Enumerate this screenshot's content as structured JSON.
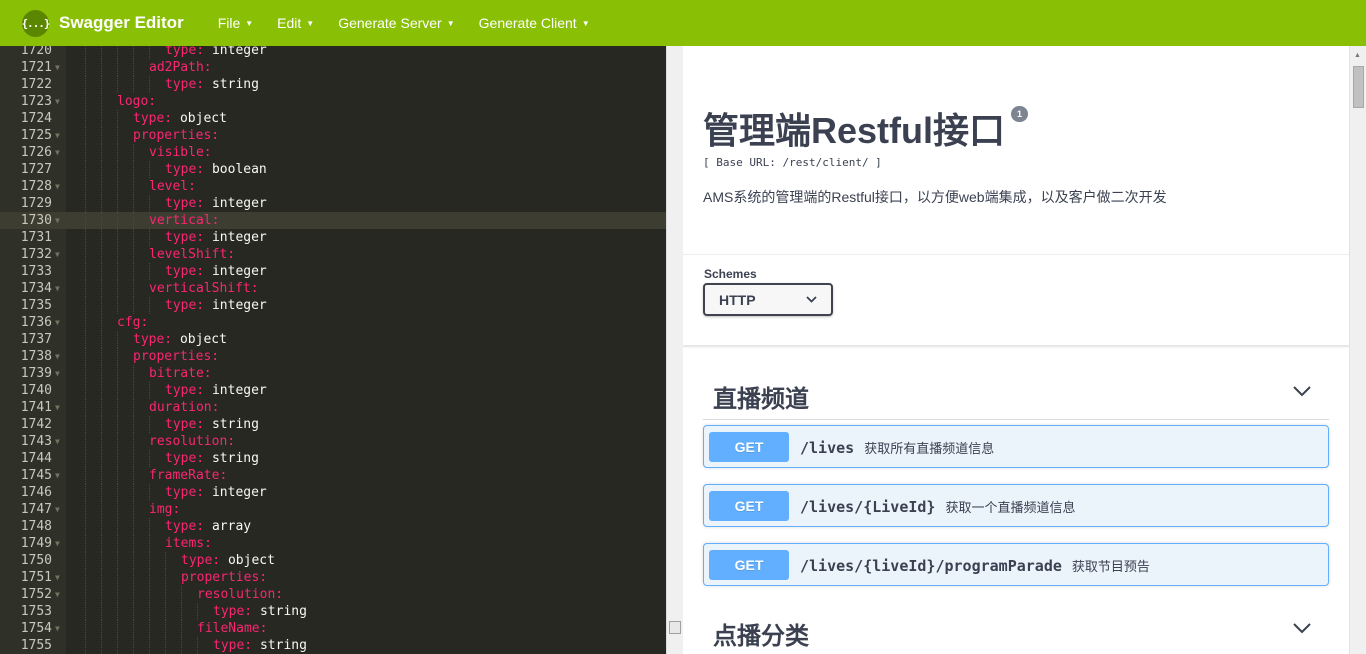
{
  "app": {
    "logo_glyph": "{...}",
    "title": "Swagger Editor",
    "menu": [
      {
        "label": "File"
      },
      {
        "label": "Edit"
      },
      {
        "label": "Generate Server"
      },
      {
        "label": "Generate Client"
      }
    ],
    "brand_color": "#89bf04"
  },
  "editor": {
    "active_line": 1730,
    "lines": [
      {
        "n": "1720",
        "indent": 6,
        "fold": false,
        "key": "type:",
        "val": " integer"
      },
      {
        "n": "1721",
        "indent": 5,
        "fold": true,
        "key": "ad2Path:",
        "val": ""
      },
      {
        "n": "1722",
        "indent": 6,
        "fold": false,
        "key": "type:",
        "val": " string"
      },
      {
        "n": "1723",
        "indent": 3,
        "fold": true,
        "key": "logo:",
        "val": ""
      },
      {
        "n": "1724",
        "indent": 4,
        "fold": false,
        "key": "type:",
        "val": " object"
      },
      {
        "n": "1725",
        "indent": 4,
        "fold": true,
        "key": "properties:",
        "val": ""
      },
      {
        "n": "1726",
        "indent": 5,
        "fold": true,
        "key": "visible:",
        "val": ""
      },
      {
        "n": "1727",
        "indent": 6,
        "fold": false,
        "key": "type:",
        "val": " boolean"
      },
      {
        "n": "1728",
        "indent": 5,
        "fold": true,
        "key": "level:",
        "val": ""
      },
      {
        "n": "1729",
        "indent": 6,
        "fold": false,
        "key": "type:",
        "val": " integer"
      },
      {
        "n": "1730",
        "indent": 5,
        "fold": true,
        "key": "vertical:",
        "val": ""
      },
      {
        "n": "1731",
        "indent": 6,
        "fold": false,
        "key": "type:",
        "val": " integer"
      },
      {
        "n": "1732",
        "indent": 5,
        "fold": true,
        "key": "levelShift:",
        "val": ""
      },
      {
        "n": "1733",
        "indent": 6,
        "fold": false,
        "key": "type:",
        "val": " integer"
      },
      {
        "n": "1734",
        "indent": 5,
        "fold": true,
        "key": "verticalShift:",
        "val": ""
      },
      {
        "n": "1735",
        "indent": 6,
        "fold": false,
        "key": "type:",
        "val": " integer"
      },
      {
        "n": "1736",
        "indent": 3,
        "fold": true,
        "key": "cfg:",
        "val": ""
      },
      {
        "n": "1737",
        "indent": 4,
        "fold": false,
        "key": "type:",
        "val": " object"
      },
      {
        "n": "1738",
        "indent": 4,
        "fold": true,
        "key": "properties:",
        "val": ""
      },
      {
        "n": "1739",
        "indent": 5,
        "fold": true,
        "key": "bitrate:",
        "val": ""
      },
      {
        "n": "1740",
        "indent": 6,
        "fold": false,
        "key": "type:",
        "val": " integer"
      },
      {
        "n": "1741",
        "indent": 5,
        "fold": true,
        "key": "duration:",
        "val": ""
      },
      {
        "n": "1742",
        "indent": 6,
        "fold": false,
        "key": "type:",
        "val": " string"
      },
      {
        "n": "1743",
        "indent": 5,
        "fold": true,
        "key": "resolution:",
        "val": ""
      },
      {
        "n": "1744",
        "indent": 6,
        "fold": false,
        "key": "type:",
        "val": " string"
      },
      {
        "n": "1745",
        "indent": 5,
        "fold": true,
        "key": "frameRate:",
        "val": ""
      },
      {
        "n": "1746",
        "indent": 6,
        "fold": false,
        "key": "type:",
        "val": " integer"
      },
      {
        "n": "1747",
        "indent": 5,
        "fold": true,
        "key": "img:",
        "val": ""
      },
      {
        "n": "1748",
        "indent": 6,
        "fold": false,
        "key": "type:",
        "val": " array"
      },
      {
        "n": "1749",
        "indent": 6,
        "fold": true,
        "key": "items:",
        "val": ""
      },
      {
        "n": "1750",
        "indent": 7,
        "fold": false,
        "key": "type:",
        "val": " object"
      },
      {
        "n": "1751",
        "indent": 7,
        "fold": true,
        "key": "properties:",
        "val": ""
      },
      {
        "n": "1752",
        "indent": 8,
        "fold": true,
        "key": "resolution:",
        "val": ""
      },
      {
        "n": "1753",
        "indent": 9,
        "fold": false,
        "key": "type:",
        "val": " string"
      },
      {
        "n": "1754",
        "indent": 8,
        "fold": true,
        "key": "fileName:",
        "val": ""
      },
      {
        "n": "1755",
        "indent": 9,
        "fold": false,
        "key": "type:",
        "val": " string"
      }
    ]
  },
  "info": {
    "title": "管理端Restful接口",
    "version": "1",
    "base_url": "[ Base URL: /rest/client/ ]",
    "description": "AMS系统的管理端的Restful接口，以方便web端集成，以及客户做二次开发"
  },
  "schemes": {
    "label": "Schemes",
    "selected": "HTTP"
  },
  "tags": [
    {
      "name": "直播频道",
      "operations": [
        {
          "method": "GET",
          "path": "/lives",
          "summary": "获取所有直播频道信息"
        },
        {
          "method": "GET",
          "path": "/lives/{LiveId}",
          "summary": "获取一个直播频道信息"
        },
        {
          "method": "GET",
          "path": "/lives/{liveId}/programParade",
          "summary": "获取节目预告"
        }
      ]
    },
    {
      "name": "点播分类",
      "operations": []
    }
  ],
  "colors": {
    "get_method": "#61affe",
    "editor_bg": "#272822",
    "yaml_key": "#f92672"
  }
}
